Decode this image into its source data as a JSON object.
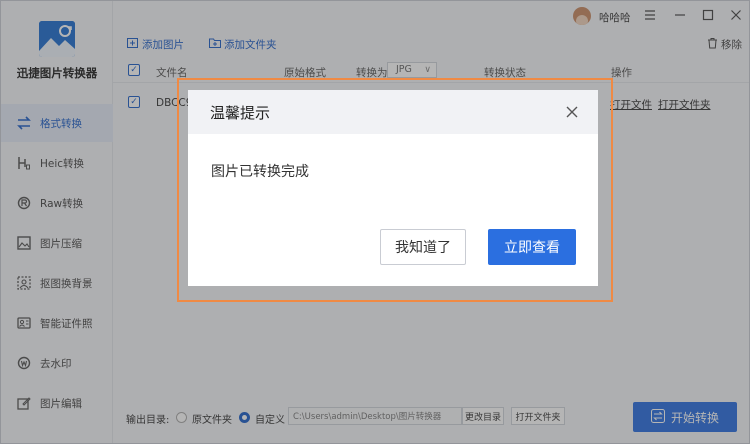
{
  "app": {
    "name": "迅捷图片转换器",
    "brand_color": "#1f6fd1",
    "accent_color": "#2b6fe0",
    "highlight_color": "#f08a44"
  },
  "titlebar": {
    "username": "哈哈哈",
    "menu_icon": "hamburger-icon",
    "minimize_icon": "minimize-icon",
    "maximize_icon": "maximize-icon",
    "close_icon": "close-icon"
  },
  "sidebar": {
    "items": [
      {
        "label": "格式转换",
        "icon": "swap-icon",
        "active": true
      },
      {
        "label": "Heic转换",
        "icon": "heic-icon",
        "active": false
      },
      {
        "label": "Raw转换",
        "icon": "raw-icon",
        "active": false
      },
      {
        "label": "图片压缩",
        "icon": "compress-icon",
        "active": false
      },
      {
        "label": "抠图换背景",
        "icon": "cutout-icon",
        "active": false
      },
      {
        "label": "智能证件照",
        "icon": "id-photo-icon",
        "active": false
      },
      {
        "label": "去水印",
        "icon": "watermark-icon",
        "active": false
      },
      {
        "label": "图片编辑",
        "icon": "edit-icon",
        "active": false
      }
    ]
  },
  "toolbar": {
    "add_image": "添加图片",
    "add_folder": "添加文件夹",
    "remove": "移除"
  },
  "table": {
    "headers": {
      "filename": "文件名",
      "original_format": "原始格式",
      "convert_to": "转换为",
      "status": "转换状态",
      "actions": "操作"
    },
    "target_format": "JPG",
    "rows": [
      {
        "filename": "DBCC92",
        "open_file": "打开文件",
        "open_folder": "打开文件夹"
      }
    ]
  },
  "bottom": {
    "output_label": "输出目录:",
    "option_original": "原文件夹",
    "option_custom": "自定义",
    "path": "C:\\Users\\admin\\Desktop\\图片转换器",
    "change_dir": "更改目录",
    "open_folder": "打开文件夹",
    "start": "开始转换"
  },
  "dialog": {
    "title": "温馨提示",
    "message": "图片已转换完成",
    "btn_ok": "我知道了",
    "btn_view": "立即查看"
  }
}
